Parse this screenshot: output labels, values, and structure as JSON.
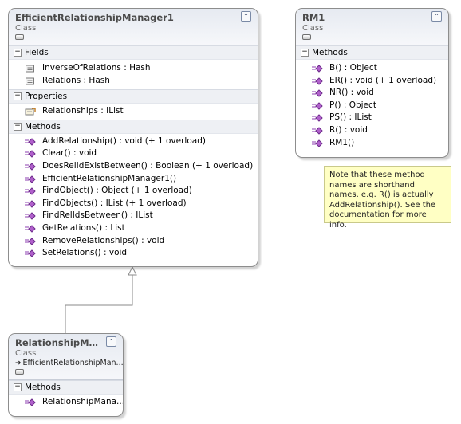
{
  "colors": {
    "purple_method": "#8e3fb0",
    "header_bg": "#e6eaf1",
    "note_bg": "#ffffc4"
  },
  "efficient": {
    "name": "EfficientRelationshipManager1",
    "stereotype": "Class",
    "fields_title": "Fields",
    "fields": [
      "InverseOfRelations : Hash",
      "Relations : Hash"
    ],
    "properties_title": "Properties",
    "properties": [
      "Relationships : IList"
    ],
    "methods_title": "Methods",
    "methods": [
      "AddRelationship() : void (+ 1 overload)",
      "Clear() : void",
      "DoesRelIdExistBetween() : Boolean (+ 1 overload)",
      "EfficientRelationshipManager1()",
      "FindObject() : Object (+ 1 overload)",
      "FindObjects() : IList (+ 1 overload)",
      "FindRelIdsBetween() : IList",
      "GetRelations() : List",
      "RemoveRelationships() : void",
      "SetRelations() : void"
    ]
  },
  "rm1": {
    "name": "RM1",
    "stereotype": "Class",
    "methods_title": "Methods",
    "methods": [
      "B() : Object",
      "ER() : void (+ 1 overload)",
      "NR() : void",
      "P() : Object",
      "PS() : IList",
      "R() : void",
      "RM1()"
    ]
  },
  "relmgr": {
    "name": "RelationshipMan...",
    "stereotype": "Class",
    "base": "EfficientRelationshipMan...",
    "methods_title": "Methods",
    "methods": [
      "RelationshipMana..."
    ]
  },
  "note": {
    "text": "Note that these method names are shorthand names. e.g. R() is actually AddRelationship().  See the documentation for more info."
  },
  "icons": {
    "collapse": "double-chevron-up-icon",
    "field": "field-icon",
    "property": "property-icon",
    "method": "method-icon",
    "inherit_arrow": "arrow-right-icon"
  }
}
